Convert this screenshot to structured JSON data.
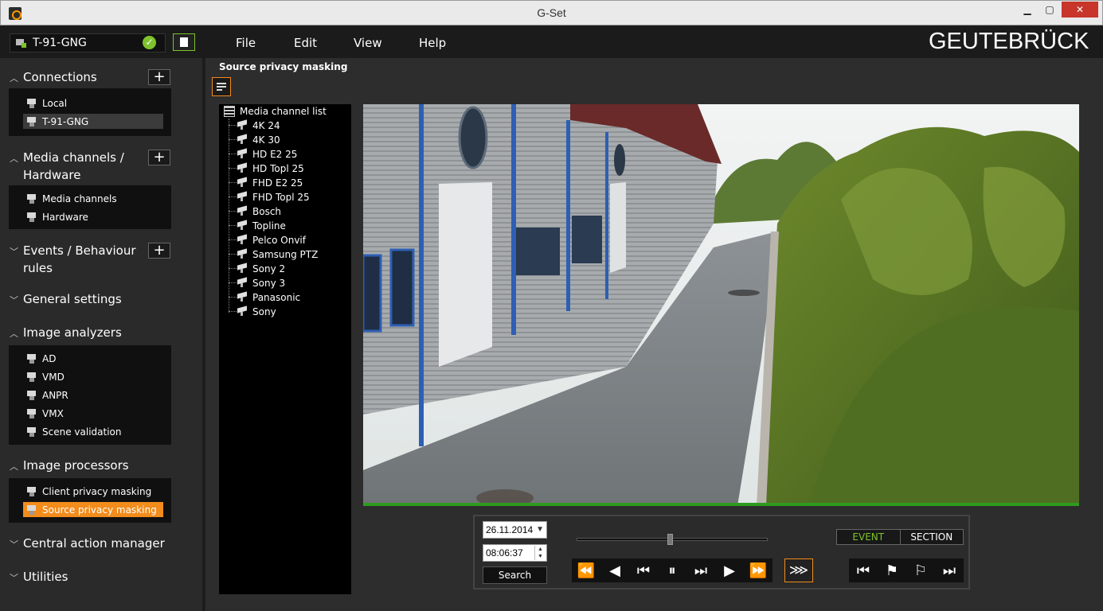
{
  "window": {
    "title": "G-Set"
  },
  "menubar": {
    "connection": "T-91-GNG",
    "items": [
      "File",
      "Edit",
      "View",
      "Help"
    ],
    "logo": "GEUTEBRÜCK"
  },
  "sidebar": {
    "connections": {
      "title": "Connections",
      "items": [
        "Local",
        "T-91-GNG"
      ]
    },
    "media": {
      "title_line1": "Media channels /",
      "title_line2": "Hardware",
      "items": [
        "Media channels",
        "Hardware"
      ]
    },
    "events": {
      "title_line1": "Events / Behaviour",
      "title_line2": "rules"
    },
    "general": {
      "title": "General settings"
    },
    "analyzers": {
      "title": "Image analyzers",
      "items": [
        "AD",
        "VMD",
        "ANPR",
        "VMX",
        "Scene validation"
      ]
    },
    "processors": {
      "title": "Image processors",
      "items": [
        "Client privacy masking",
        "Source privacy masking"
      ]
    },
    "central": {
      "title": "Central action manager"
    },
    "utilities": {
      "title": "Utilities"
    }
  },
  "main": {
    "title": "Source privacy masking",
    "tree": {
      "root": "Media channel list",
      "items": [
        "4K 24",
        "4K 30",
        "HD E2 25",
        "HD Topl 25",
        "FHD E2 25",
        "FHD Topl 25",
        "Bosch",
        "Topline",
        "Pelco Onvif",
        "Samsung PTZ",
        "Sony 2",
        "Sony 3",
        "Panasonic",
        "Sony"
      ]
    },
    "playback": {
      "date": "26.11.2014",
      "time": "08:06:37",
      "search_label": "Search",
      "mode_event": "EVENT",
      "mode_section": "SECTION",
      "slider_position": 0.49
    }
  },
  "colors": {
    "accent": "#f28c1c",
    "ok": "#7ec22d",
    "progress": "#2e9b1f"
  }
}
